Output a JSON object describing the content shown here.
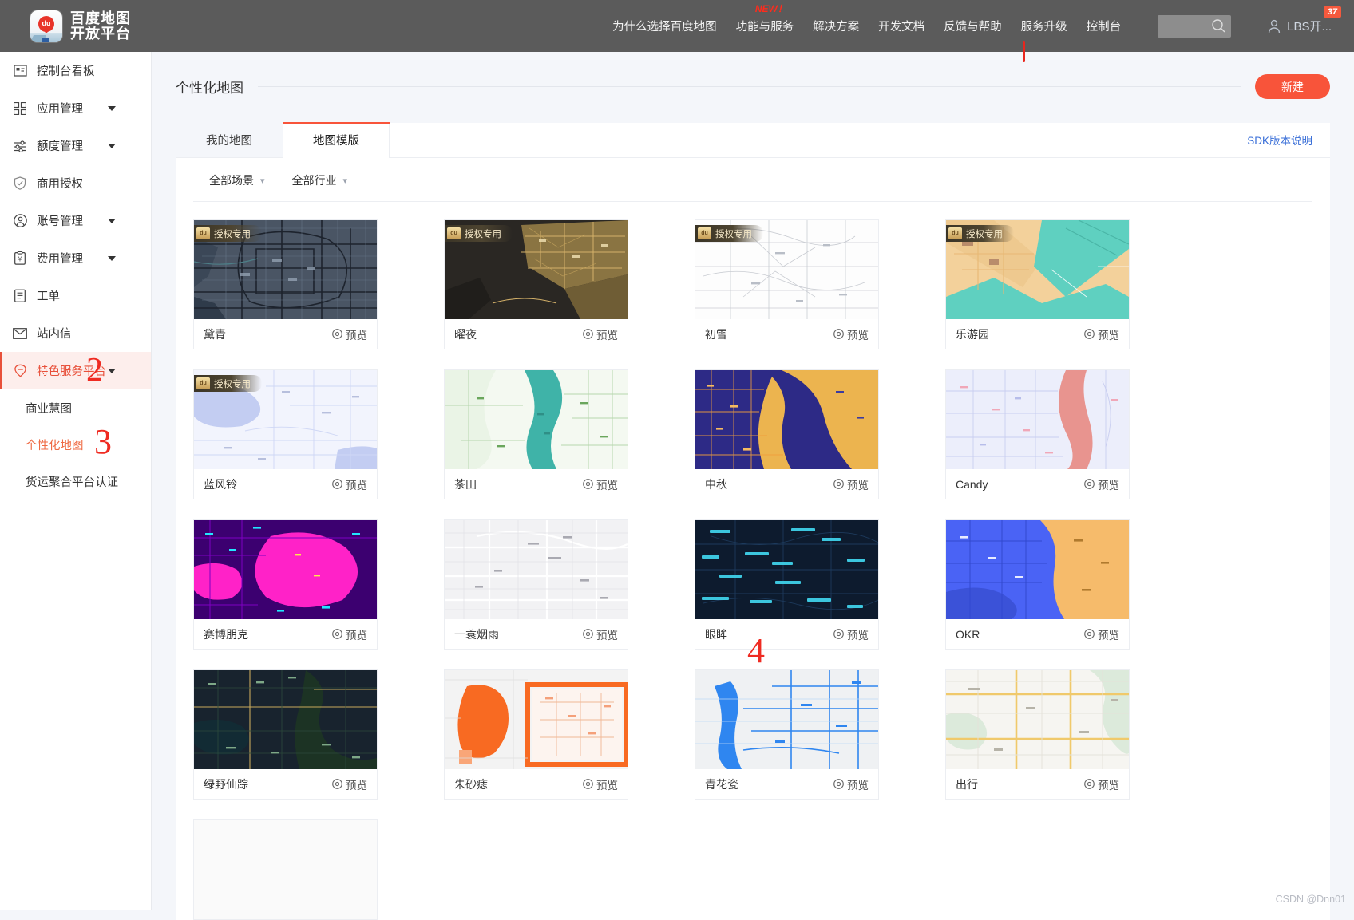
{
  "header": {
    "logo_line1": "百度地图",
    "logo_line2": "开放平台",
    "logo_mark": "du",
    "nav": [
      {
        "label": "为什么选择百度地图",
        "new_tag": ""
      },
      {
        "label": "功能与服务",
        "new_tag": "NEW！"
      },
      {
        "label": "解决方案",
        "new_tag": ""
      },
      {
        "label": "开发文档",
        "new_tag": ""
      },
      {
        "label": "反馈与帮助",
        "new_tag": ""
      },
      {
        "label": "服务升级",
        "new_tag": ""
      },
      {
        "label": "控制台",
        "new_tag": ""
      }
    ],
    "search_icon": "search-icon",
    "user_name": "LBS开...",
    "user_icon": "user-avatar-icon",
    "notification_count": "37"
  },
  "sidebar": {
    "items": [
      {
        "label": "控制台看板",
        "icon": "dashboard-icon",
        "caret": false,
        "active": false
      },
      {
        "label": "应用管理",
        "icon": "apps-grid-icon",
        "caret": true,
        "active": false
      },
      {
        "label": "额度管理",
        "icon": "sliders-icon",
        "caret": true,
        "active": false
      },
      {
        "label": "商用授权",
        "icon": "shield-check-icon",
        "caret": false,
        "active": false
      },
      {
        "label": "账号管理",
        "icon": "user-circle-icon",
        "caret": true,
        "active": false
      },
      {
        "label": "费用管理",
        "icon": "yen-clipboard-icon",
        "caret": true,
        "active": false
      },
      {
        "label": "工单",
        "icon": "clipboard-icon",
        "caret": false,
        "active": false
      },
      {
        "label": "站内信",
        "icon": "envelope-icon",
        "caret": false,
        "active": false
      },
      {
        "label": "特色服务平台",
        "icon": "location-shield-icon",
        "caret": true,
        "active": true
      }
    ],
    "subitems": [
      {
        "label": "商业慧图",
        "current": false
      },
      {
        "label": "个性化地图",
        "current": true
      },
      {
        "label": "货运聚合平台认证",
        "current": false
      }
    ]
  },
  "main": {
    "page_title": "个性化地图",
    "new_button": "新建",
    "sdk_link": "SDK版本说明",
    "tabs": [
      {
        "label": "我的地图",
        "active": false
      },
      {
        "label": "地图模版",
        "active": true
      }
    ],
    "filters": [
      {
        "label": "全部场景",
        "icon": "chevron-down-icon"
      },
      {
        "label": "全部行业",
        "icon": "chevron-down-icon"
      }
    ],
    "preview_label": "预览",
    "preview_icon": "eye-icon",
    "auth_badge": "授权专用",
    "cards": [
      {
        "name": "黛青",
        "authorized": true,
        "style": "dark-slate"
      },
      {
        "name": "曜夜",
        "authorized": true,
        "style": "dark-gold"
      },
      {
        "name": "初雪",
        "authorized": true,
        "style": "white-line"
      },
      {
        "name": "乐游园",
        "authorized": true,
        "style": "sand-teal"
      },
      {
        "name": "蓝风铃",
        "authorized": true,
        "style": "pale-blue"
      },
      {
        "name": "茶田",
        "authorized": false,
        "style": "green-tea"
      },
      {
        "name": "中秋",
        "authorized": false,
        "style": "indigo-gold"
      },
      {
        "name": "Candy",
        "authorized": false,
        "style": "candy-pink"
      },
      {
        "name": "赛博朋克",
        "authorized": false,
        "style": "cyberpunk"
      },
      {
        "name": "一蓑烟雨",
        "authorized": false,
        "style": "light-gray"
      },
      {
        "name": "眼眸",
        "authorized": false,
        "style": "navy-label"
      },
      {
        "name": "OKR",
        "authorized": false,
        "style": "blue-orange"
      },
      {
        "name": "绿野仙踪",
        "authorized": false,
        "style": "dark-green"
      },
      {
        "name": "朱砂痣",
        "authorized": false,
        "style": "orange-red"
      },
      {
        "name": "青花瓷",
        "authorized": false,
        "style": "porcelain-blue"
      },
      {
        "name": "出行",
        "authorized": false,
        "style": "travel-light"
      }
    ]
  },
  "annotations": {
    "mark_1": "|",
    "mark_2": "2",
    "mark_3": "3",
    "mark_4": "4"
  },
  "watermark": "CSDN @Dnn01",
  "colors": {
    "accent": "#f8543a",
    "header_bg": "#5b5b5b",
    "page_bg": "#f4f6fa",
    "link": "#3a6fd8",
    "annotation": "#ef2b22",
    "active_sidebar_bg": "#fdeeec",
    "active_sidebar_text": "#e8503a"
  }
}
